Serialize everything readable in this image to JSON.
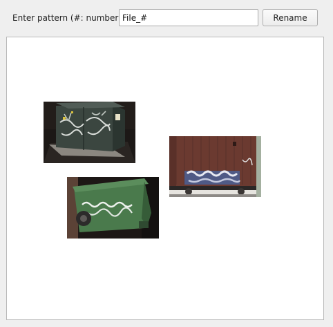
{
  "toolbar": {
    "pattern_label": "Enter pattern (#: number):",
    "pattern_value": "File_#",
    "rename_label": "Rename"
  },
  "images": [
    {
      "subject": "graffiti-covered electrical utility box at night"
    },
    {
      "subject": "graffiti on a brown freight boxcar"
    },
    {
      "subject": "green trash bin with white graffiti at night"
    }
  ],
  "colors": {
    "window_background": "#efefef",
    "canvas_background": "#ffffff",
    "utility_box": "#36403a",
    "boxcar": "#6b3a30",
    "trash_bin": "#4a7a4c"
  }
}
